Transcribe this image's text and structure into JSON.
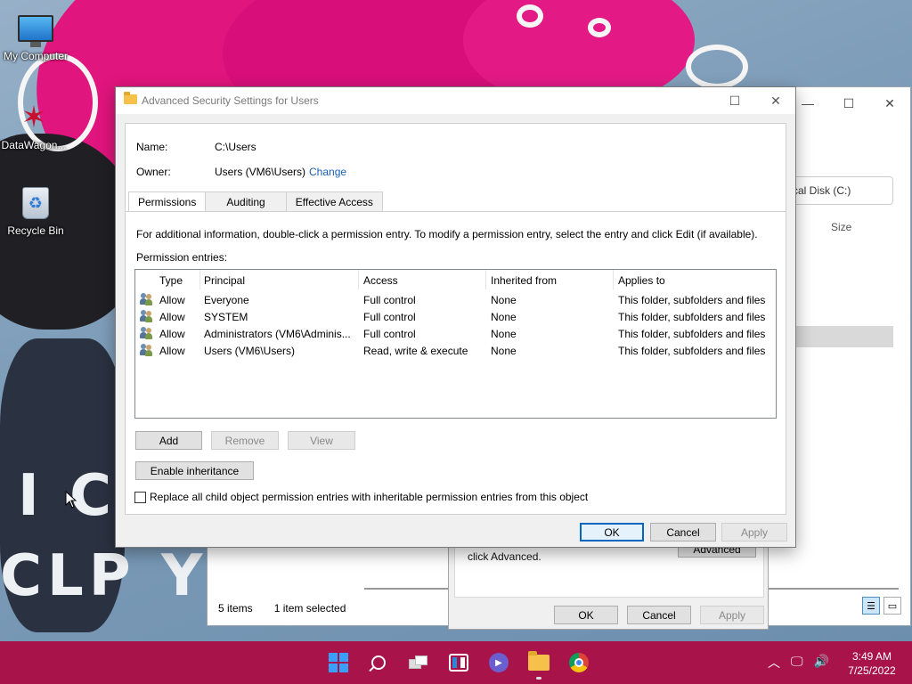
{
  "desktop": {
    "icons": [
      {
        "label": "My Computer"
      },
      {
        "label": "DataWagon..."
      },
      {
        "label": "Recycle Bin"
      }
    ]
  },
  "background_window": {
    "address": "cal Disk (C:)",
    "col_size": "Size",
    "status_items": "5 items",
    "status_selected": "1 item selected"
  },
  "properties_dialog": {
    "text": "click Advanced.",
    "advanced_label": "Advanced",
    "ok_label": "OK",
    "cancel_label": "Cancel",
    "apply_label": "Apply"
  },
  "dialog": {
    "title": "Advanced Security Settings for Users",
    "name_label": "Name:",
    "name_value": "C:\\Users",
    "owner_label": "Owner:",
    "owner_value": "Users (VM6\\Users)",
    "change_link": "Change",
    "tabs": [
      {
        "label": "Permissions",
        "active": true
      },
      {
        "label": "Auditing",
        "active": false
      },
      {
        "label": "Effective Access",
        "active": false
      }
    ],
    "info_text": "For additional information, double-click a permission entry. To modify a permission entry, select the entry and click Edit (if available).",
    "entries_label": "Permission entries:",
    "columns": [
      "Type",
      "Principal",
      "Access",
      "Inherited from",
      "Applies to"
    ],
    "rows": [
      {
        "type": "Allow",
        "principal": "Everyone",
        "access": "Full control",
        "inherited": "None",
        "applies": "This folder, subfolders and files"
      },
      {
        "type": "Allow",
        "principal": "SYSTEM",
        "access": "Full control",
        "inherited": "None",
        "applies": "This folder, subfolders and files"
      },
      {
        "type": "Allow",
        "principal": "Administrators (VM6\\Adminis...",
        "access": "Full control",
        "inherited": "None",
        "applies": "This folder, subfolders and files"
      },
      {
        "type": "Allow",
        "principal": "Users (VM6\\Users)",
        "access": "Read, write & execute",
        "inherited": "None",
        "applies": "This folder, subfolders and files"
      }
    ],
    "add_label": "Add",
    "remove_label": "Remove",
    "view_label": "View",
    "enable_inheritance_label": "Enable inheritance",
    "replace_checkbox_label": "Replace all child object permission entries with inheritable permission entries from this object",
    "replace_checked": false,
    "ok_label": "OK",
    "cancel_label": "Cancel",
    "apply_label": "Apply"
  },
  "taskbar": {
    "time": "3:49 AM",
    "date": "7/25/2022",
    "apps": [
      "start-icon",
      "search-icon",
      "task-view-icon",
      "widgets-icon",
      "teams-icon",
      "file-explorer-icon",
      "chrome-icon"
    ]
  }
}
